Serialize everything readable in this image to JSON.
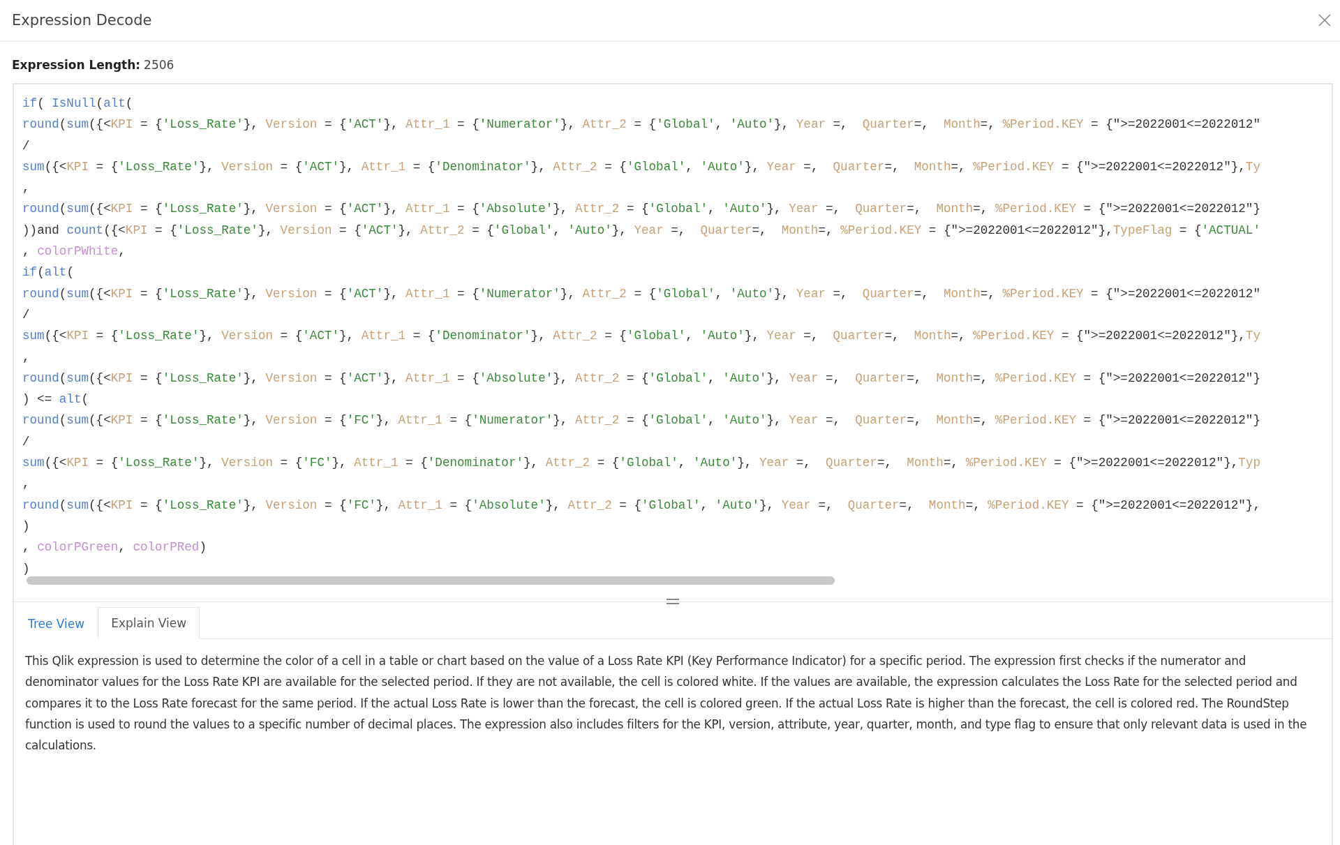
{
  "dialog": {
    "title": "Expression Decode"
  },
  "expression_length": {
    "label": "Expression Length:",
    "value": "2506"
  },
  "code_lines": [
    "if( IsNull(alt(",
    "round(sum({<KPI = {'Loss_Rate'}, Version = {'ACT'}, Attr_1 = {'Numerator'}, Attr_2 = {'Global', 'Auto'}, Year =,  Quarter=,  Month=, %Period.KEY = {\">=2022001<=2022012\"",
    "/",
    "sum({<KPI = {'Loss_Rate'}, Version = {'ACT'}, Attr_1 = {'Denominator'}, Attr_2 = {'Global', 'Auto'}, Year =,  Quarter=,  Month=, %Period.KEY = {\">=2022001<=2022012\"},Ty",
    ",",
    "round(sum({<KPI = {'Loss_Rate'}, Version = {'ACT'}, Attr_1 = {'Absolute'}, Attr_2 = {'Global', 'Auto'}, Year =,  Quarter=,  Month=, %Period.KEY = {\">=2022001<=2022012\"}",
    "))and count({<KPI = {'Loss_Rate'}, Version = {'ACT'}, Attr_2 = {'Global', 'Auto'}, Year =,  Quarter=,  Month=, %Period.KEY = {\">=2022001<=2022012\"},TypeFlag = {'ACTUAL'",
    ", colorPWhite,",
    "if(alt(",
    "round(sum({<KPI = {'Loss_Rate'}, Version = {'ACT'}, Attr_1 = {'Numerator'}, Attr_2 = {'Global', 'Auto'}, Year =,  Quarter=,  Month=, %Period.KEY = {\">=2022001<=2022012\"",
    "/",
    "sum({<KPI = {'Loss_Rate'}, Version = {'ACT'}, Attr_1 = {'Denominator'}, Attr_2 = {'Global', 'Auto'}, Year =,  Quarter=,  Month=, %Period.KEY = {\">=2022001<=2022012\"},Ty",
    ",",
    "round(sum({<KPI = {'Loss_Rate'}, Version = {'ACT'}, Attr_1 = {'Absolute'}, Attr_2 = {'Global', 'Auto'}, Year =,  Quarter=,  Month=, %Period.KEY = {\">=2022001<=2022012\"}",
    ") <= alt(",
    "round(sum({<KPI = {'Loss_Rate'}, Version = {'FC'}, Attr_1 = {'Numerator'}, Attr_2 = {'Global', 'Auto'}, Year =,  Quarter=,  Month=, %Period.KEY = {\">=2022001<=2022012\"}",
    "/",
    "sum({<KPI = {'Loss_Rate'}, Version = {'FC'}, Attr_1 = {'Denominator'}, Attr_2 = {'Global', 'Auto'}, Year =,  Quarter=,  Month=, %Period.KEY = {\">=2022001<=2022012\"},Typ",
    ",",
    "round(sum({<KPI = {'Loss_Rate'}, Version = {'FC'}, Attr_1 = {'Absolute'}, Attr_2 = {'Global', 'Auto'}, Year =,  Quarter=,  Month=, %Period.KEY = {\">=2022001<=2022012\"},",
    ")",
    ", colorPGreen, colorPRed)",
    ")"
  ],
  "tabs": [
    {
      "label": "Tree View",
      "selected": false
    },
    {
      "label": "Explain View",
      "selected": true
    }
  ],
  "explanation": "This Qlik expression is used to determine the color of a cell in a table or chart based on the value of a Loss Rate KPI (Key Performance Indicator) for a specific period. The expression first checks if the numerator and denominator values for the Loss Rate KPI are available for the selected period. If they are not available, the cell is colored white. If the values are available, the expression calculates the Loss Rate for the selected period and compares it to the Loss Rate forecast for the same period. If the actual Loss Rate is lower than the forecast, the cell is colored green. If the actual Loss Rate is higher than the forecast, the cell is colored red. The RoundStep function is used to round the values to a specific number of decimal places. The expression also includes filters for the KPI, version, attribute, year, quarter, month, and type flag to ensure that only relevant data is used in the calculations."
}
